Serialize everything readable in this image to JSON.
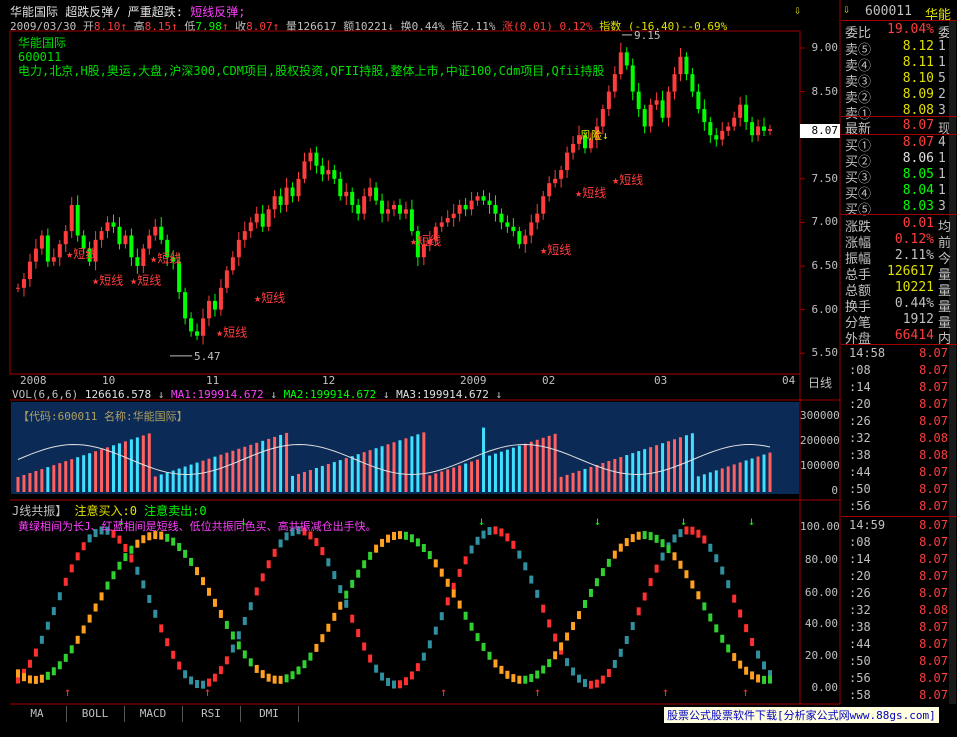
{
  "header": {
    "stock_name": "华能国际",
    "indicator_title": "超跌反弹/",
    "strong_label": "严重超跌",
    "strong_value": "短线反弹;",
    "date": "2009/03/30",
    "open_label": "开",
    "open": "8.10",
    "high_label": "高",
    "high": "8.15",
    "low_label": "低",
    "low": "7.98",
    "close_label": "收",
    "close": "8.07",
    "vol_label": "量",
    "vol": "126617",
    "amount_label": "额",
    "amount": "10221",
    "turnover_label": "换",
    "turnover": "0.44%",
    "amplitude_label": "振",
    "amplitude": "2.11%",
    "change_label": "涨",
    "change": "(0.01)",
    "change_pct": "0.12%",
    "index_label": "指数",
    "index_val": "(-16.40)",
    "index_pct": "-0.69%"
  },
  "info": {
    "name": "华能国际",
    "code": "600011",
    "concepts": "电力,北京,H股,奥运,大盘,沪深300,CDM项目,股权投资,QFII持股,整体上市,中证100,Cdm项目,Qfii持股"
  },
  "price_chart": {
    "y_ticks": [
      "9.00",
      "8.50",
      "8.00",
      "7.50",
      "7.00",
      "6.50",
      "6.00",
      "5.50"
    ],
    "current_price": "8.07",
    "max_label": "9.15",
    "min_label": "5.47",
    "signal_label": "短线",
    "signal_alt": "风险",
    "x_labels": [
      "2008",
      "10",
      "11",
      "12",
      "2009",
      "02",
      "03",
      "04"
    ],
    "period": "日线"
  },
  "volume_panel": {
    "header_name": "VOL(6,6,6)",
    "vol_value": "126616.578",
    "ma1": "MA1:199914.672",
    "ma2": "MA2:199914.672",
    "ma3": "MA3:199914.672",
    "code_tag": "【代码:600011 名称:华能国际】",
    "y_ticks": [
      "300000",
      "200000",
      "100000",
      "0"
    ]
  },
  "osc_panel": {
    "title": "J线共振】",
    "buy_label": "注意买入:0",
    "sell_label": "注意卖出:0",
    "note": "黄绿相间为长J、红蓝相间是短线、低位共振同色买、高共振减仓出手快。",
    "y_ticks": [
      "100.00",
      "80.00",
      "60.00",
      "40.00",
      "20.00",
      "0.00"
    ]
  },
  "right_panel": {
    "code": "600011",
    "name": "华能",
    "weibi_label": "委比",
    "weibi": "19.04%",
    "weibi_tail": "委",
    "sells": [
      {
        "label": "卖⑤",
        "price": "8.12",
        "tail": "1"
      },
      {
        "label": "卖④",
        "price": "8.11",
        "tail": "1"
      },
      {
        "label": "卖③",
        "price": "8.10",
        "tail": "5"
      },
      {
        "label": "卖②",
        "price": "8.09",
        "tail": "2"
      },
      {
        "label": "卖①",
        "price": "8.08",
        "tail": "3"
      }
    ],
    "latest_label": "最新",
    "latest": "8.07",
    "latest_tail": "现",
    "buys": [
      {
        "label": "买①",
        "price": "8.07",
        "tail": "4"
      },
      {
        "label": "买②",
        "price": "8.06",
        "tail": "1"
      },
      {
        "label": "买③",
        "price": "8.05",
        "tail": "1"
      },
      {
        "label": "买④",
        "price": "8.04",
        "tail": "1"
      },
      {
        "label": "买⑤",
        "price": "8.03",
        "tail": "3"
      }
    ],
    "stats": [
      {
        "label": "涨跌",
        "value": "0.01",
        "tail": "均",
        "color": "#ff3d3d"
      },
      {
        "label": "涨幅",
        "value": "0.12%",
        "tail": "前",
        "color": "#ff3d3d"
      },
      {
        "label": "振幅",
        "value": "2.11%",
        "tail": "今",
        "color": "#c0c0c0"
      },
      {
        "label": "总手",
        "value": "126617",
        "tail": "量",
        "color": "#e0e000"
      },
      {
        "label": "总额",
        "value": "10221",
        "tail": "量",
        "color": "#e0e000"
      },
      {
        "label": "换手",
        "value": "0.44%",
        "tail": "量",
        "color": "#c0c0c0"
      },
      {
        "label": "分笔",
        "value": "1912",
        "tail": "量",
        "color": "#c0c0c0"
      },
      {
        "label": "外盘",
        "value": "66414",
        "tail": "内",
        "color": "#ff3d3d"
      }
    ],
    "ticks1": [
      {
        "t": "14:58",
        "p": "8.07"
      },
      {
        "t": ":08",
        "p": "8.07"
      },
      {
        "t": ":14",
        "p": "8.07"
      },
      {
        "t": ":20",
        "p": "8.07"
      },
      {
        "t": ":26",
        "p": "8.07"
      },
      {
        "t": ":32",
        "p": "8.08"
      },
      {
        "t": ":38",
        "p": "8.08"
      },
      {
        "t": ":44",
        "p": "8.07"
      },
      {
        "t": ":50",
        "p": "8.07"
      },
      {
        "t": ":56",
        "p": "8.07"
      }
    ],
    "ticks2": [
      {
        "t": "14:59",
        "p": "8.07"
      },
      {
        "t": ":08",
        "p": "8.07"
      },
      {
        "t": ":14",
        "p": "8.07"
      },
      {
        "t": ":20",
        "p": "8.07"
      },
      {
        "t": ":26",
        "p": "8.07"
      },
      {
        "t": ":32",
        "p": "8.08"
      },
      {
        "t": ":38",
        "p": "8.07"
      },
      {
        "t": ":44",
        "p": "8.07"
      },
      {
        "t": ":50",
        "p": "8.07"
      },
      {
        "t": ":56",
        "p": "8.07"
      },
      {
        "t": ":58",
        "p": "8.07"
      }
    ]
  },
  "tabs": [
    "MA",
    "BOLL",
    "MACD",
    "RSI",
    "DMI"
  ],
  "watermark": "股票公式股票软件下载[分析家公式网www.88gs.com]",
  "colors": {
    "up": "#ff3d3d",
    "down": "#00ff00",
    "bg": "#000000",
    "grid": "#a00000",
    "accent": "#00ffff",
    "vol_bg": "#0b2a55"
  }
}
